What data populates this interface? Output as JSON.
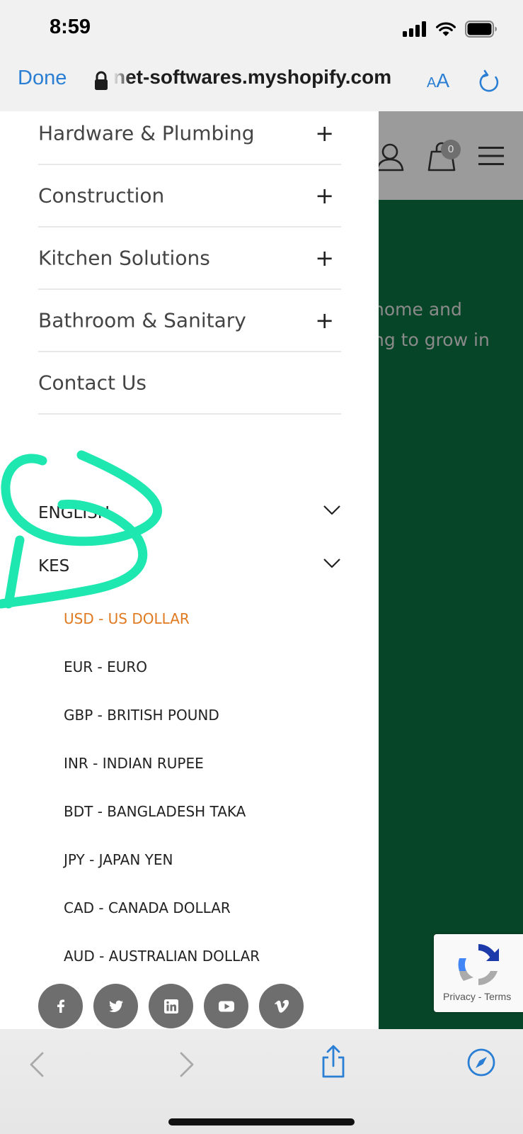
{
  "status_bar": {
    "time": "8:59"
  },
  "browser": {
    "done_label": "Done",
    "url": "net-softwares.myshopify.com",
    "aa_small": "A",
    "aa_big": "A"
  },
  "page_background": {
    "cart_count": "0",
    "text_line_1": "home and",
    "text_line_2": "ng to grow in",
    "recaptcha_text": "Privacy - Terms",
    "header_color": "#9b9b9b",
    "hero_color": "#074528"
  },
  "drawer": {
    "menu_items": [
      {
        "label": "Hardware & Plumbing",
        "expand": "+"
      },
      {
        "label": "Construction",
        "expand": "+"
      },
      {
        "label": "Kitchen Solutions",
        "expand": "+"
      },
      {
        "label": "Bathroom & Sanitary",
        "expand": "+"
      },
      {
        "label": "Contact Us",
        "expand": ""
      }
    ],
    "language_select": "ENGLISH",
    "currency_select": "KES",
    "currency_options": [
      {
        "label": "USD - US DOLLAR",
        "active": true
      },
      {
        "label": "EUR - EURO",
        "active": false
      },
      {
        "label": "GBP - BRITISH POUND",
        "active": false
      },
      {
        "label": "INR - INDIAN RUPEE",
        "active": false
      },
      {
        "label": "BDT - BANGLADESH TAKA",
        "active": false
      },
      {
        "label": "JPY - JAPAN YEN",
        "active": false
      },
      {
        "label": "CAD - CANADA DOLLAR",
        "active": false
      },
      {
        "label": "AUD - AUSTRALIAN DOLLAR",
        "active": false
      }
    ],
    "active_currency_color": "#e07a20",
    "social_icons": [
      "facebook-icon",
      "twitter-icon",
      "linkedin-icon",
      "youtube-icon",
      "vimeo-icon"
    ]
  },
  "colors": {
    "accent_blue": "#2a7fd4",
    "annotation_green": "#1ee8b0"
  }
}
